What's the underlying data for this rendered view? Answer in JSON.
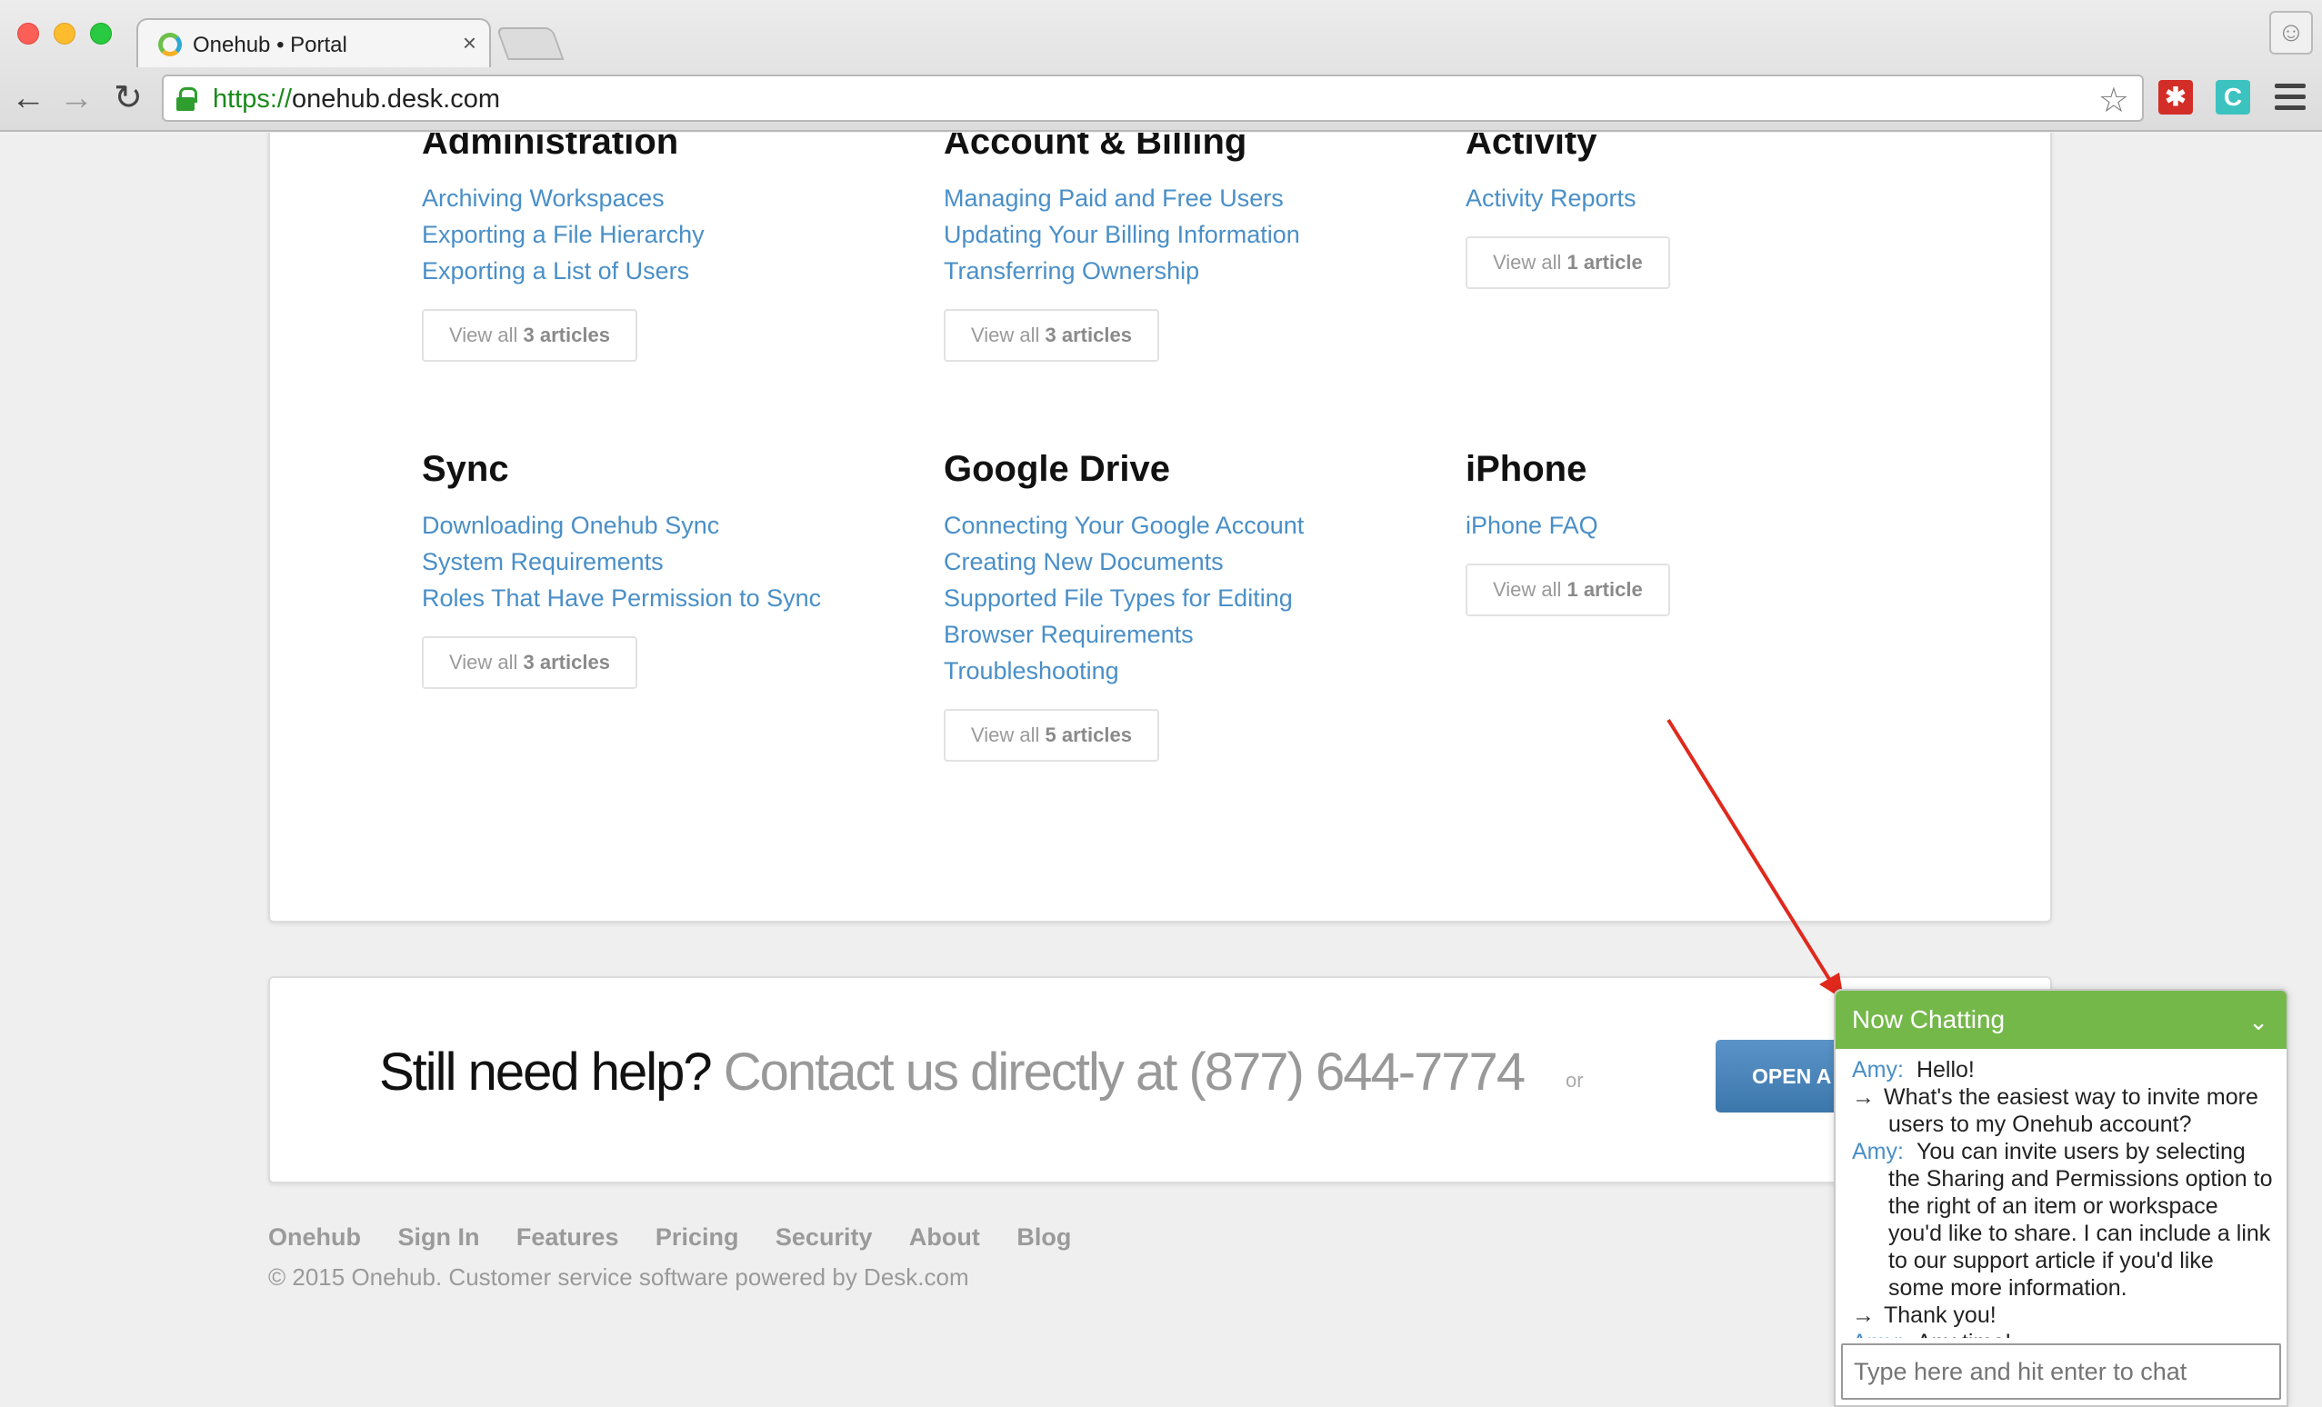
{
  "browser": {
    "tab_title": "Onehub • Portal",
    "tab_close": "×",
    "url_protocol": "https://",
    "url_rest": "onehub.desk.com",
    "back_glyph": "←",
    "forward_glyph": "→",
    "reload_glyph": "↻",
    "star_glyph": "☆",
    "ext_lastpass_glyph": "✱",
    "ext_c_glyph": "C",
    "profile_glyph": "☺",
    "icons": [
      "lock-icon",
      "star-icon",
      "lastpass-extension-icon",
      "c-extension-icon",
      "menu-icon",
      "profile-icon"
    ]
  },
  "categories": [
    {
      "title": "Administration",
      "links": [
        "Archiving Workspaces",
        "Exporting a File Hierarchy",
        "Exporting a List of Users"
      ],
      "view_all_prefix": "View all ",
      "view_all_count": "3 articles"
    },
    {
      "title": "Account & Billing",
      "links": [
        "Managing Paid and Free Users",
        "Updating Your Billing Information",
        "Transferring Ownership"
      ],
      "view_all_prefix": "View all ",
      "view_all_count": "3 articles"
    },
    {
      "title": "Activity",
      "links": [
        "Activity Reports"
      ],
      "view_all_prefix": "View all ",
      "view_all_count": "1 article"
    },
    {
      "title": "Sync",
      "links": [
        "Downloading Onehub Sync",
        "System Requirements",
        "Roles That Have Permission to Sync"
      ],
      "view_all_prefix": "View all ",
      "view_all_count": "3 articles"
    },
    {
      "title": "Google Drive",
      "links": [
        "Connecting Your Google Account",
        "Creating New Documents",
        "Supported File Types for Editing",
        "Browser Requirements",
        "Troubleshooting"
      ],
      "view_all_prefix": "View all ",
      "view_all_count": "5 articles"
    },
    {
      "title": "iPhone",
      "links": [
        "iPhone FAQ"
      ],
      "view_all_prefix": "View all ",
      "view_all_count": "1 article"
    }
  ],
  "help": {
    "lead": "Still need help?",
    "contact": "Contact us directly at (877) 644-7774",
    "or": "or",
    "button": "OPEN A"
  },
  "footer": {
    "links": [
      "Onehub",
      "Sign In",
      "Features",
      "Pricing",
      "Security",
      "About",
      "Blog"
    ],
    "copyright": "© 2015 Onehub. Customer service software powered by Desk.com"
  },
  "chat": {
    "header": "Now Chatting",
    "chevron": "⌄",
    "user_arrow": "→",
    "messages": [
      {
        "from": "agent",
        "name": "Amy:",
        "text": "Hello!"
      },
      {
        "from": "user",
        "text": "What's the easiest way to invite more users to my Onehub account?"
      },
      {
        "from": "agent",
        "name": "Amy:",
        "text": "You can invite users by selecting the Sharing and Permissions option to the right of an item or workspace you'd like to share. I can include a link to our support article if you'd like some more information."
      },
      {
        "from": "user",
        "text": "Thank you!"
      },
      {
        "from": "agent",
        "name": "Amy:",
        "text": "Any time!"
      }
    ],
    "input_placeholder": "Type here and hit enter to chat"
  },
  "colors": {
    "link": "#4a8fc7",
    "chat_header": "#74b84a",
    "annotation_arrow": "#e0281c",
    "button": "#3c77ac"
  }
}
